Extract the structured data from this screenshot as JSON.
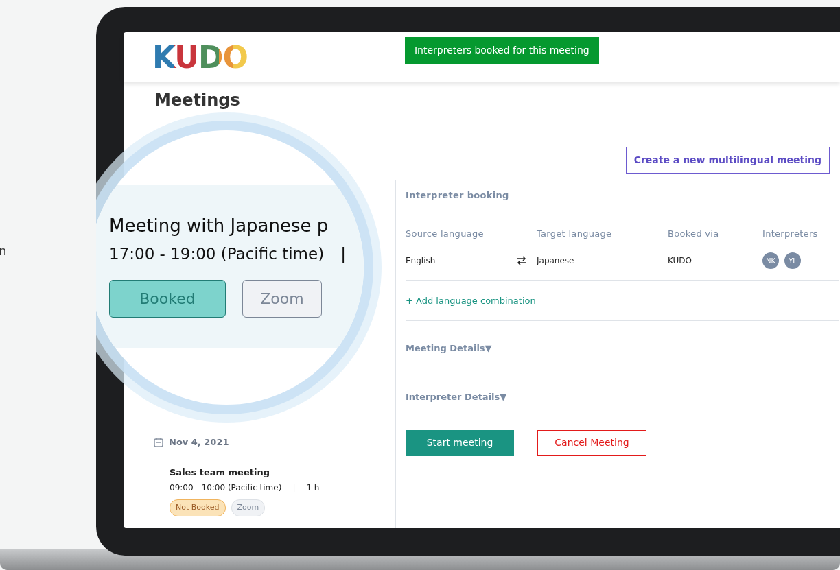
{
  "background": {
    "edge_text": "n"
  },
  "header": {
    "logo": "KUDO",
    "toast": "Interpreters booked for this meeting"
  },
  "page": {
    "title": "Meetings",
    "create_button": "Create a new multilingual meeting"
  },
  "magnifier": {
    "title": "Meeting with Japanese p",
    "time": "17:00 - 19:00 (Pacific time)",
    "separator": "|",
    "tags": [
      {
        "label": "Booked",
        "kind": "booked"
      },
      {
        "label": "Zoom",
        "kind": "platform"
      }
    ]
  },
  "meetings": [
    {
      "date": "Nov 4, 2021",
      "items": [
        {
          "title": "Sales team meeting",
          "time": "09:00 - 10:00 (Pacific time)",
          "separator": "|",
          "duration": "1 h",
          "tags": [
            {
              "label": "Not Booked",
              "kind": "not_booked"
            },
            {
              "label": "Zoom",
              "kind": "platform"
            }
          ]
        }
      ]
    }
  ],
  "booking": {
    "title": "Interpreter booking",
    "columns": [
      "Source language",
      "Target language",
      "Booked via",
      "Interpreters"
    ],
    "rows": [
      {
        "source": "English",
        "target": "Japanese",
        "booked_via": "KUDO",
        "interpreters": [
          "NK",
          "YL"
        ]
      }
    ],
    "add_link": "+ Add language combination",
    "sections": [
      "Meeting Details▼",
      "Interpreter Details▼"
    ],
    "actions": [
      {
        "label": "Start meeting",
        "kind": "primary"
      },
      {
        "label": "Cancel Meeting",
        "kind": "danger"
      }
    ]
  }
}
